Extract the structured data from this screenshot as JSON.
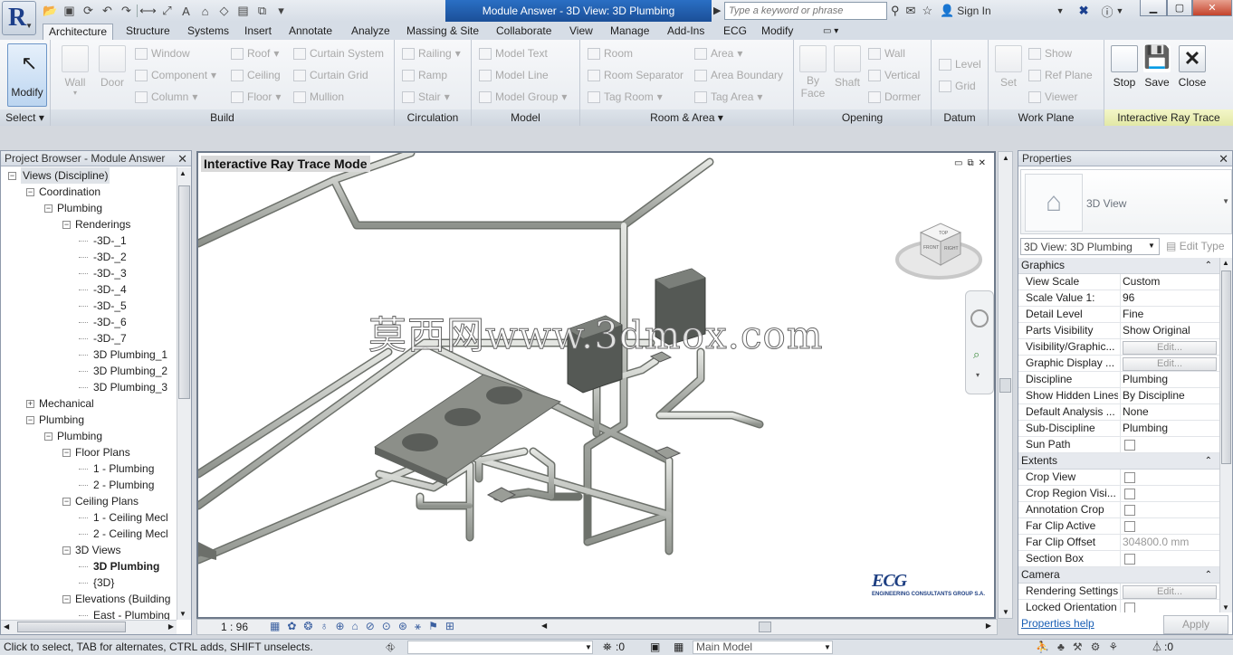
{
  "window": {
    "title": "Module Answer - 3D View: 3D Plumbing",
    "search_placeholder": "Type a keyword or phrase",
    "sign_in": "Sign In"
  },
  "app_logo": "R",
  "tabs": [
    "Architecture",
    "Structure",
    "Systems",
    "Insert",
    "Annotate",
    "Analyze",
    "Massing & Site",
    "Collaborate",
    "View",
    "Manage",
    "Add-Ins",
    "ECG",
    "Modify"
  ],
  "ribbon": {
    "select": {
      "modify": "Modify",
      "label": "Select"
    },
    "build": {
      "label": "Build",
      "wall": "Wall",
      "door": "Door",
      "window": "Window",
      "component": "Component",
      "column": "Column",
      "roof": "Roof",
      "ceiling": "Ceiling",
      "floor": "Floor",
      "curtain_system": "Curtain System",
      "curtain_grid": "Curtain Grid",
      "mullion": "Mullion"
    },
    "circulation": {
      "label": "Circulation",
      "railing": "Railing",
      "ramp": "Ramp",
      "stair": "Stair"
    },
    "model": {
      "label": "Model",
      "model_text": "Model Text",
      "model_line": "Model Line",
      "model_group": "Model Group"
    },
    "room_area": {
      "label": "Room & Area",
      "room": "Room",
      "room_separator": "Room Separator",
      "tag_room": "Tag Room",
      "area": "Area",
      "area_boundary": "Area Boundary",
      "tag_area": "Tag Area"
    },
    "opening": {
      "label": "Opening",
      "by_face_1": "By",
      "by_face_2": "Face",
      "shaft": "Shaft",
      "wall": "Wall",
      "vertical": "Vertical",
      "dormer": "Dormer"
    },
    "datum": {
      "label": "Datum",
      "level": "Level",
      "grid": "Grid"
    },
    "work_plane": {
      "label": "Work Plane",
      "set": "Set",
      "show": "Show",
      "ref_plane": "Ref Plane",
      "viewer": "Viewer"
    },
    "ray_trace": {
      "label": "Interactive Ray Trace",
      "stop": "Stop",
      "save": "Save",
      "close": "Close"
    }
  },
  "project_browser": {
    "title": "Project Browser - Module Answer",
    "nodes": [
      {
        "t": "Views (Discipline)",
        "d": 0,
        "e": "-",
        "sel": true
      },
      {
        "t": "Coordination",
        "d": 1,
        "e": "-"
      },
      {
        "t": "Plumbing",
        "d": 2,
        "e": "-"
      },
      {
        "t": "Renderings",
        "d": 3,
        "e": "-"
      },
      {
        "t": "-3D-_1",
        "d": 4
      },
      {
        "t": "-3D-_2",
        "d": 4
      },
      {
        "t": "-3D-_3",
        "d": 4
      },
      {
        "t": "-3D-_4",
        "d": 4
      },
      {
        "t": "-3D-_5",
        "d": 4
      },
      {
        "t": "-3D-_6",
        "d": 4
      },
      {
        "t": "-3D-_7",
        "d": 4
      },
      {
        "t": "3D Plumbing_1",
        "d": 4
      },
      {
        "t": "3D Plumbing_2",
        "d": 4
      },
      {
        "t": "3D Plumbing_3",
        "d": 4
      },
      {
        "t": "Mechanical",
        "d": 1,
        "e": "+"
      },
      {
        "t": "Plumbing",
        "d": 1,
        "e": "-"
      },
      {
        "t": "Plumbing",
        "d": 2,
        "e": "-"
      },
      {
        "t": "Floor Plans",
        "d": 3,
        "e": "-"
      },
      {
        "t": "1 - Plumbing",
        "d": 4
      },
      {
        "t": "2 - Plumbing",
        "d": 4
      },
      {
        "t": "Ceiling Plans",
        "d": 3,
        "e": "-"
      },
      {
        "t": "1 - Ceiling Mecl",
        "d": 4
      },
      {
        "t": "2 - Ceiling Mecl",
        "d": 4
      },
      {
        "t": "3D Views",
        "d": 3,
        "e": "-"
      },
      {
        "t": "3D Plumbing",
        "d": 4,
        "bold": true
      },
      {
        "t": "{3D}",
        "d": 4
      },
      {
        "t": "Elevations (Building",
        "d": 3,
        "e": "-"
      },
      {
        "t": "East - Plumbing",
        "d": 4
      }
    ]
  },
  "viewport": {
    "mode_label": "Interactive Ray Trace Mode",
    "watermark": "莫西网www.3dmox.com",
    "logo_text": "ECG",
    "logo_sub": "ENGINEERING CONSULTANTS GROUP S.A.",
    "viewcube_faces": [
      "TOP",
      "FRONT",
      "RIGHT"
    ],
    "scale": "1 : 96"
  },
  "properties": {
    "title": "Properties",
    "type_name": "3D View",
    "type_selector": "3D View: 3D Plumbing",
    "edit_type": "Edit Type",
    "groups": [
      {
        "name": "Graphics",
        "rows": [
          {
            "k": "View Scale",
            "v": "Custom"
          },
          {
            "k": "Scale Value    1:",
            "v": "96"
          },
          {
            "k": "Detail Level",
            "v": "Fine"
          },
          {
            "k": "Parts Visibility",
            "v": "Show Original"
          },
          {
            "k": "Visibility/Graphic...",
            "v": "Edit...",
            "btn": true
          },
          {
            "k": "Graphic Display ...",
            "v": "Edit...",
            "btn": true
          },
          {
            "k": "Discipline",
            "v": "Plumbing"
          },
          {
            "k": "Show Hidden Lines",
            "v": "By Discipline"
          },
          {
            "k": "Default Analysis ...",
            "v": "None"
          },
          {
            "k": "Sub-Discipline",
            "v": "Plumbing"
          },
          {
            "k": "Sun Path",
            "cb": true
          }
        ]
      },
      {
        "name": "Extents",
        "rows": [
          {
            "k": "Crop View",
            "cb": true
          },
          {
            "k": "Crop Region Visi...",
            "cb": true
          },
          {
            "k": "Annotation Crop",
            "cb": true
          },
          {
            "k": "Far Clip Active",
            "cb": true
          },
          {
            "k": "Far Clip Offset",
            "v": "304800.0 mm",
            "dim": true
          },
          {
            "k": "Section Box",
            "cb": true
          }
        ]
      },
      {
        "name": "Camera",
        "rows": [
          {
            "k": "Rendering Settings",
            "v": "Edit...",
            "btn": true
          },
          {
            "k": "Locked Orientation",
            "cb": true
          }
        ]
      }
    ],
    "help": "Properties help",
    "apply": "Apply"
  },
  "status": {
    "hint": "Click to select, TAB for alternates, CTRL adds, SHIFT unselects.",
    "workset": ":0",
    "model": "Main Model",
    "filter": ":0"
  }
}
